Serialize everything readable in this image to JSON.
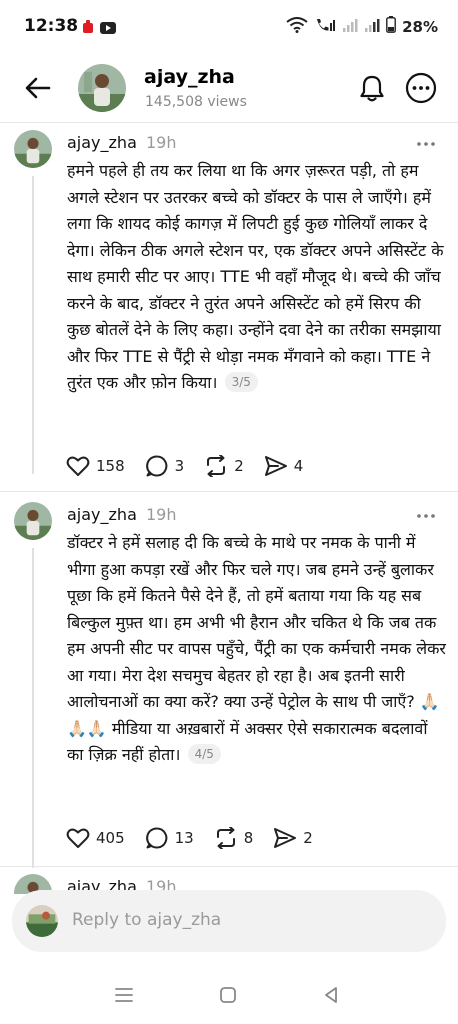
{
  "status_bar": {
    "time": "12:38",
    "battery": "28%",
    "icons": [
      "notification-app-icon",
      "youtube-icon",
      "wifi-icon",
      "call-icon",
      "signal-icon",
      "signal-icon-2",
      "battery-icon"
    ]
  },
  "header": {
    "name": "ajay_zha",
    "views": "145,508 views"
  },
  "posts": [
    {
      "user": "ajay_zha",
      "time": "19h",
      "text": "हमने पहले ही तय कर लिया था कि अगर ज़रूरत पड़ी, तो हम अगले स्टेशन पर उतरकर बच्चे को डॉक्टर के पास ले जाएँगे। हमें लगा कि शायद कोई कागज़ में लिपटी हुई कुछ गोलियाँ लाकर दे देगा। लेकिन ठीक अगले स्टेशन पर, एक डॉक्टर अपने असिस्टेंट के साथ हमारी सीट पर आए। TTE भी वहाँ मौजूद थे। बच्चे की जाँच करने के बाद, डॉक्टर ने तुरंत अपने असिस्टेंट को हमें सिरप की कुछ बोतलें देने के लिए कहा। उन्होंने दवा देने का तरीका समझाया और फिर TTE से पैंट्री से थोड़ा नमक मँगवाने को कहा। TTE ने तुरंत एक और फ़ोन किया।",
      "badge": "3/5",
      "likes": "158",
      "comments": "3",
      "reposts": "2",
      "shares": "4"
    },
    {
      "user": "ajay_zha",
      "time": "19h",
      "text": "डॉक्टर ने हमें सलाह दी कि बच्चे के माथे पर नमक के पानी में भीगा हुआ कपड़ा रखें और फिर चले गए। जब हमने उन्हें बुलाकर पूछा कि हमें कितने पैसे देने हैं, तो हमें बताया गया कि यह सब बिल्कुल मुफ़्त था। हम अभी भी हैरान और चकित थे कि जब तक हम अपनी सीट पर वापस पहुँचे, पैंट्री का एक कर्मचारी नमक लेकर आ गया। मेरा देश सचमुच बेहतर हो रहा है। अब इतनी सारी आलोचनाओं का क्या करें? क्या उन्हें पेट्रोल के साथ पी जाएँ? 🙏🏻🙏🏻🙏🏻 मीडिया या अख़बारों में अक्सर ऐसे सकारात्मक बदलावों का ज़िक्र नहीं होता।",
      "badge": "4/5",
      "likes": "405",
      "comments": "13",
      "reposts": "8",
      "shares": "2"
    },
    {
      "user": "ajay_zha",
      "time": "19h"
    }
  ],
  "reply": {
    "placeholder": "Reply to ajay_zha"
  },
  "nav": [
    "recents-icon",
    "home-icon",
    "back-nav-icon"
  ]
}
